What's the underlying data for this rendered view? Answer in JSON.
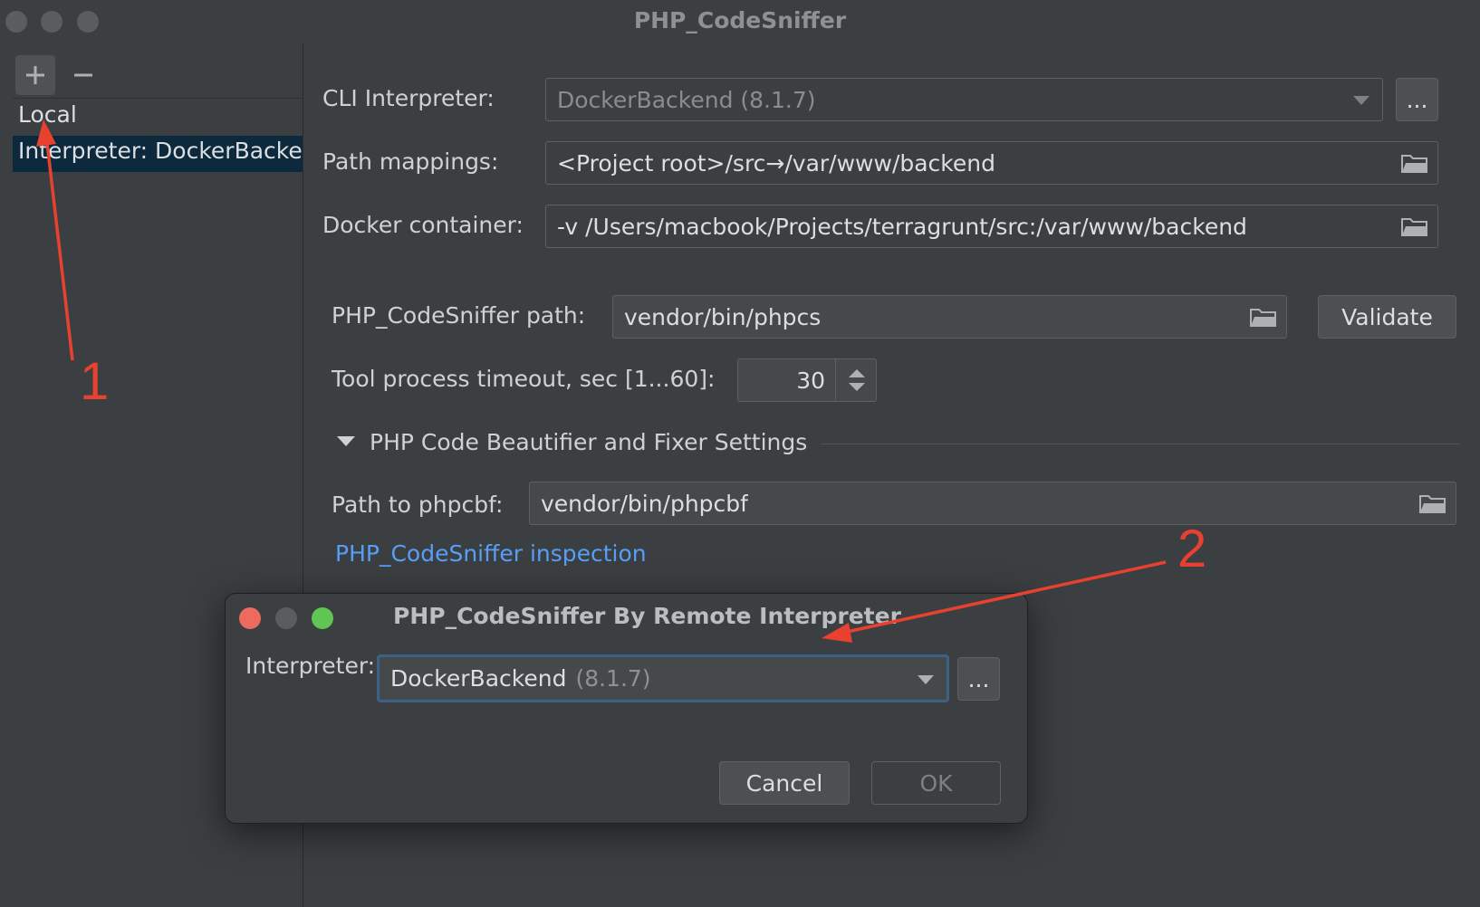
{
  "window": {
    "title": "PHP_CodeSniffer"
  },
  "sidebar": {
    "add_label": "+",
    "remove_label": "−",
    "items": [
      {
        "label": "Local"
      },
      {
        "label": "Interpreter: DockerBackend"
      }
    ]
  },
  "form": {
    "cli_interpreter": {
      "label": "CLI Interpreter:",
      "value": "DockerBackend (8.1.7)",
      "more_label": "..."
    },
    "path_mappings": {
      "label": "Path mappings:",
      "value": "<Project root>/src→/var/www/backend"
    },
    "docker_container": {
      "label": "Docker container:",
      "value": "-v /Users/macbook/Projects/terragrunt/src:/var/www/backend"
    },
    "phpcs_path": {
      "label": "PHP_CodeSniffer path:",
      "value": "vendor/bin/phpcs",
      "validate_label": "Validate"
    },
    "timeout": {
      "label": "Tool process timeout, sec [1...60]:",
      "value": "30"
    },
    "beautifier_section": {
      "label": "PHP Code Beautifier and Fixer Settings"
    },
    "phpcbf_path": {
      "label": "Path to phpcbf:",
      "value": "vendor/bin/phpcbf"
    },
    "inspection_link": "PHP_CodeSniffer inspection"
  },
  "dialog": {
    "title": "PHP_CodeSniffer By Remote Interpreter",
    "interpreter_label": "Interpreter:",
    "interpreter_name": "DockerBackend",
    "interpreter_version": "(8.1.7)",
    "more_label": "...",
    "cancel_label": "Cancel",
    "ok_label": "OK",
    "traffic_colors": [
      "#ed6a5e",
      "#5a5c5e",
      "#61c554"
    ]
  },
  "annotations": {
    "arrow_1_label": "1",
    "arrow_2_label": "2",
    "color": "#e8412f"
  }
}
